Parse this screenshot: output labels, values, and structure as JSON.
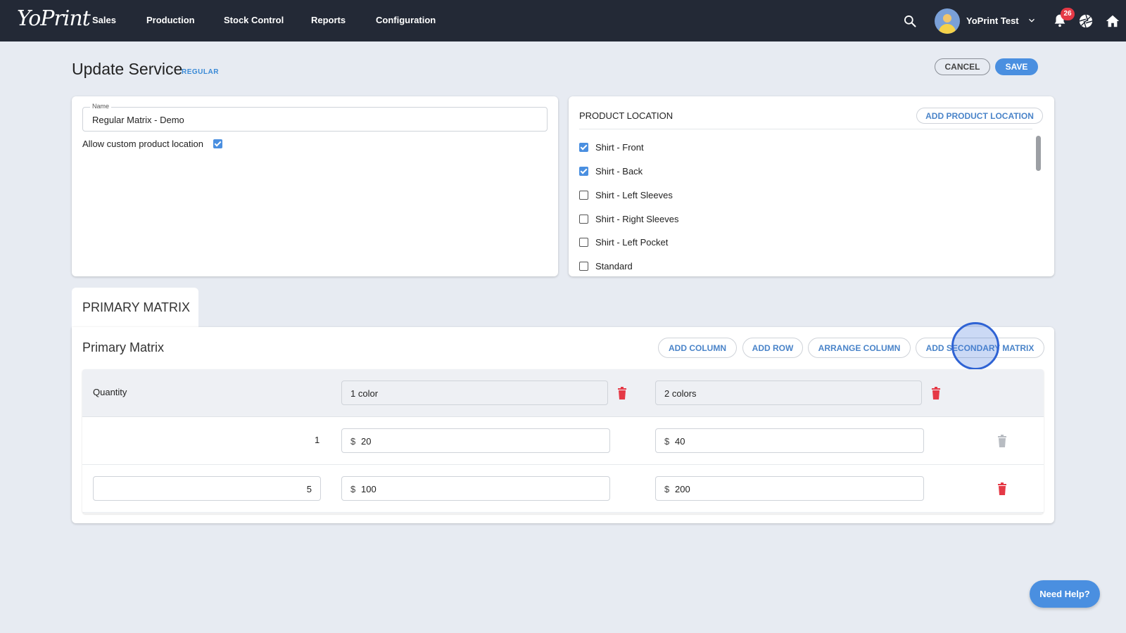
{
  "nav": {
    "logo": "YoPrint",
    "items": [
      "Sales",
      "Production",
      "Stock Control",
      "Reports",
      "Configuration"
    ],
    "user_name": "YoPrint Test",
    "notification_count": "26"
  },
  "header": {
    "title": "Update Service",
    "badge": "REGULAR",
    "cancel_label": "CANCEL",
    "save_label": "SAVE"
  },
  "service": {
    "name_label": "Name",
    "name_value": "Regular Matrix - Demo",
    "allow_custom_label": "Allow custom product location",
    "allow_custom_checked": true
  },
  "product_location": {
    "title": "PRODUCT LOCATION",
    "add_label": "ADD PRODUCT LOCATION",
    "items": [
      {
        "label": "Shirt - Front",
        "checked": true
      },
      {
        "label": "Shirt - Back",
        "checked": true
      },
      {
        "label": "Shirt - Left Sleeves",
        "checked": false
      },
      {
        "label": "Shirt - Right Sleeves",
        "checked": false
      },
      {
        "label": "Shirt - Left Pocket",
        "checked": false
      },
      {
        "label": "Standard",
        "checked": false
      }
    ]
  },
  "matrix": {
    "tab_label": "PRIMARY MATRIX",
    "title": "Primary Matrix",
    "buttons": [
      "ADD COLUMN",
      "ADD ROW",
      "ARRANGE COLUMN",
      "ADD SECONDARY MATRIX"
    ],
    "quantity_label": "Quantity",
    "columns": [
      "1 color",
      "2 colors"
    ],
    "currency": "$",
    "rows": [
      {
        "quantity": "1",
        "prices": [
          "20",
          "40"
        ]
      },
      {
        "quantity": "5",
        "prices": [
          "100",
          "200"
        ]
      }
    ]
  },
  "help_label": "Need Help?",
  "colors": {
    "nav_bg": "#232936",
    "accent": "#4a8fe0",
    "danger": "#e53946",
    "page_bg": "#e7ebf2"
  }
}
